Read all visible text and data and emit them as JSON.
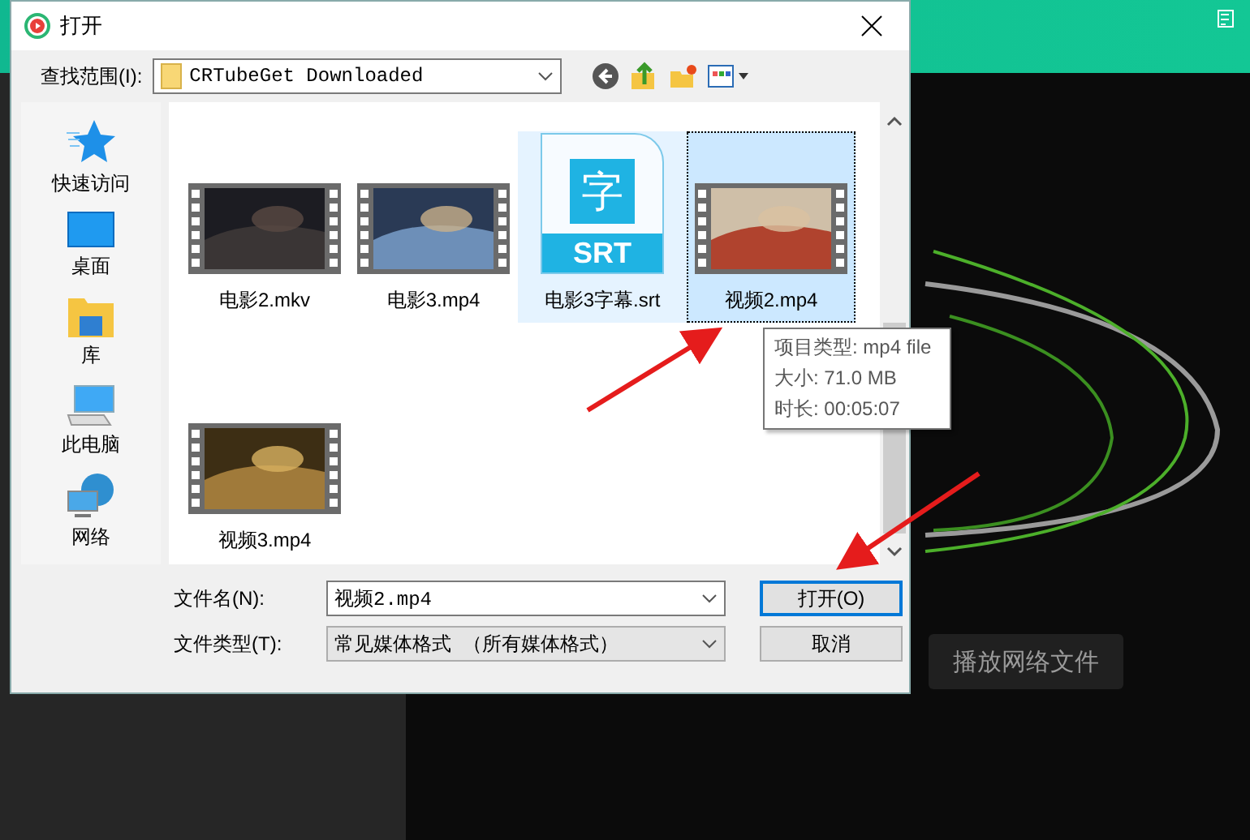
{
  "window": {
    "title": "打开"
  },
  "look_in": {
    "label": "查找范围(I):",
    "value": "CRTubeGet Downloaded"
  },
  "places": [
    {
      "label": "快速访问",
      "kind": "star"
    },
    {
      "label": "桌面",
      "kind": "desktop"
    },
    {
      "label": "库",
      "kind": "library"
    },
    {
      "label": "此电脑",
      "kind": "computer"
    },
    {
      "label": "网络",
      "kind": "network"
    }
  ],
  "files": [
    {
      "name": "电影2.mkv",
      "kind": "video",
      "selected": false,
      "hovered": false
    },
    {
      "name": "电影3.mp4",
      "kind": "video",
      "selected": false,
      "hovered": false
    },
    {
      "name": "电影3字幕.srt",
      "kind": "subtitle",
      "glyph": "字",
      "badge": "SRT",
      "selected": false,
      "hovered": true
    },
    {
      "name": "视频2.mp4",
      "kind": "video",
      "selected": true,
      "hovered": false
    },
    {
      "name": "视频3.mp4",
      "kind": "video",
      "selected": false,
      "hovered": false
    }
  ],
  "tooltip": {
    "lines": [
      "项目类型: mp4 file",
      "大小: 71.0 MB",
      "时长: 00:05:07"
    ]
  },
  "file_name": {
    "label": "文件名(N):",
    "value": "视频2.mp4"
  },
  "file_type": {
    "label": "文件类型(T):",
    "value": "常见媒体格式 （所有媒体格式）"
  },
  "buttons": [
    {
      "label": "打开(O)",
      "default": true
    },
    {
      "label": "取消",
      "default": false
    }
  ],
  "background_app": {
    "button": "播放网络文件"
  }
}
